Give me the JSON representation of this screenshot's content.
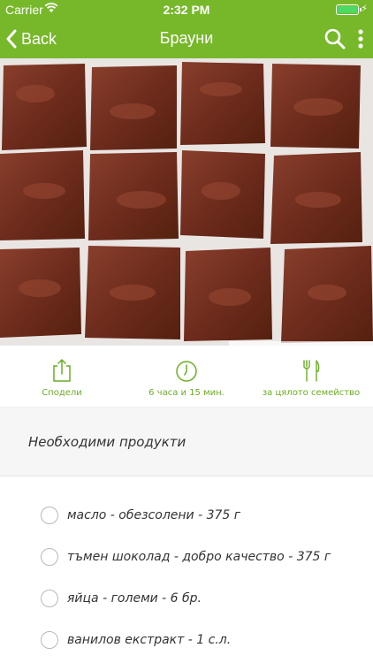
{
  "status": {
    "carrier": "Carrier",
    "time": "2:32 PM"
  },
  "nav": {
    "back_label": "Back",
    "title": "Брауни"
  },
  "actions": [
    {
      "label": "Сподели",
      "icon": "share-icon"
    },
    {
      "label": "6 часа и 15 мин.",
      "icon": "clock-icon"
    },
    {
      "label": "за цялото семейство",
      "icon": "fork-knife-icon"
    }
  ],
  "ingredients": {
    "title": "Необходими продукти",
    "items": [
      "масло - обезсолени - 375 г",
      "тъмен шоколад - добро качество - 375 г",
      "яйца - големи - 6 бр.",
      "ванилов екстракт - 1 с.л."
    ]
  },
  "colors": {
    "accent": "#77b82a",
    "accent_text": "#6aad23"
  }
}
